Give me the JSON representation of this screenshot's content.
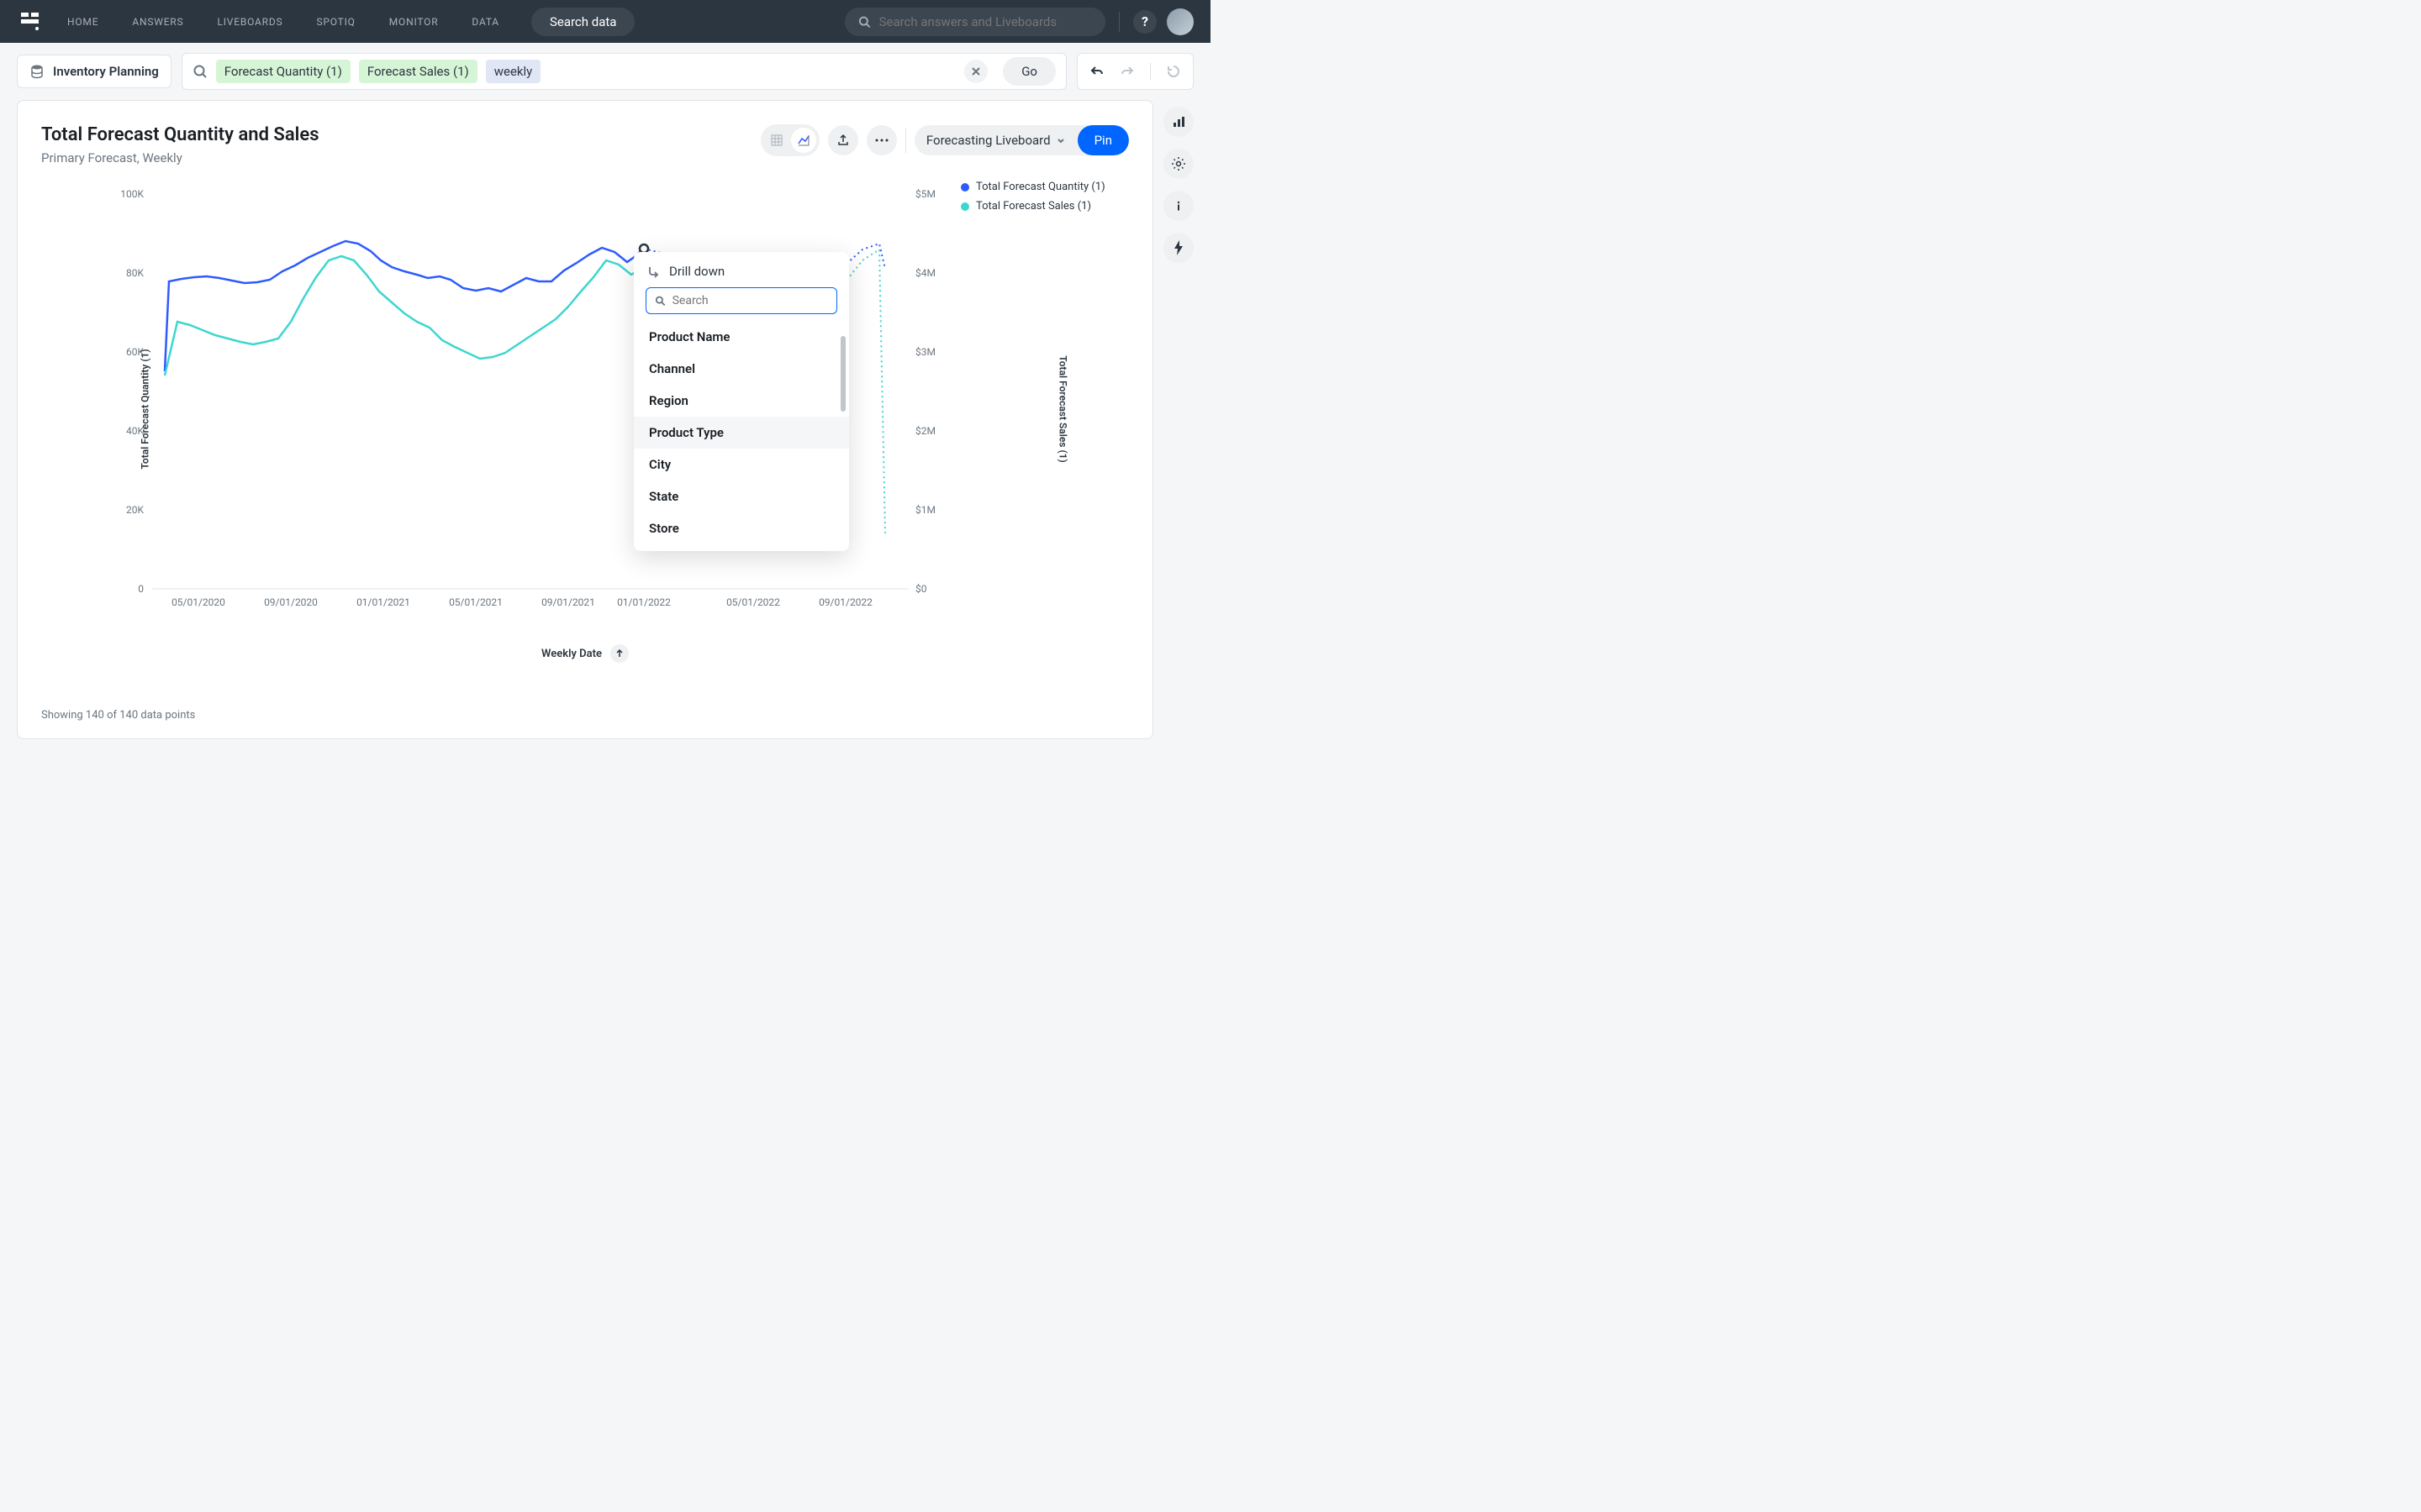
{
  "nav": {
    "items": [
      "HOME",
      "ANSWERS",
      "LIVEBOARDS",
      "SPOTIQ",
      "MONITOR",
      "DATA"
    ],
    "search_data_btn": "Search data",
    "global_search_placeholder": "Search answers and Liveboards"
  },
  "datasource": "Inventory Planning",
  "search_tokens": {
    "t0": "Forecast Quantity (1)",
    "t1": "Forecast Sales (1)",
    "t2": "weekly"
  },
  "go_btn": "Go",
  "chart": {
    "title": "Total Forecast Quantity and Sales",
    "subtitle": "Primary Forecast, Weekly",
    "liveboard_name": "Forecasting Liveboard",
    "pin_btn": "Pin",
    "y_left_label": "Total Forecast Quantity (1)",
    "y_right_label": "Total Forecast Sales (1)",
    "x_label": "Weekly Date",
    "legend": {
      "s0": "Total Forecast Quantity (1)",
      "s1": "Total Forecast Sales (1)"
    },
    "y_left_ticks": [
      "100K",
      "80K",
      "60K",
      "40K",
      "20K",
      "0"
    ],
    "y_right_ticks": [
      "$5M",
      "$4M",
      "$3M",
      "$2M",
      "$1M",
      "$0"
    ],
    "x_ticks": [
      "05/01/2020",
      "09/01/2020",
      "01/01/2021",
      "05/01/2021",
      "09/01/2021",
      "01/01/2022",
      "05/01/2022",
      "09/01/2022"
    ],
    "footer": "Showing 140 of 140 data points"
  },
  "drilldown": {
    "title": "Drill down",
    "search_placeholder": "Search",
    "items": [
      "Product Name",
      "Channel",
      "Region",
      "Product Type",
      "City",
      "State",
      "Store"
    ]
  },
  "chart_data": {
    "type": "line",
    "xlabel": "Weekly Date",
    "x_range": [
      "03/2020",
      "11/2022"
    ],
    "series": [
      {
        "name": "Total Forecast Quantity (1)",
        "color": "#2d5bff",
        "ylabel": "Total Forecast Quantity (1)",
        "ylim": [
          0,
          100000
        ],
        "values_approx": [
          55000,
          78000,
          80000,
          80000,
          81000,
          80000,
          79000,
          78000,
          79000,
          82000,
          85000,
          86000,
          88000,
          89000,
          87000,
          84000,
          82000,
          79000,
          80000,
          78000,
          77000,
          76000,
          72000,
          71000,
          72000,
          70000,
          72000,
          74000,
          73000,
          72000,
          73000,
          76000,
          79000,
          82000,
          85000,
          88000,
          87000,
          82000,
          84000,
          86000,
          88000,
          89000
        ]
      },
      {
        "name": "Total Forecast Sales (1)",
        "color": "#3dd6d0",
        "ylabel": "Total Forecast Sales (1)",
        "ylim": [
          0,
          5000000
        ],
        "values_approx": [
          2700000,
          3400000,
          3350000,
          3200000,
          3100000,
          3050000,
          3000000,
          2950000,
          3000000,
          3050000,
          3400000,
          3900000,
          4150000,
          4200000,
          4180000,
          4000000,
          3700000,
          3600000,
          3500000,
          3300000,
          3150000,
          3100000,
          2950000,
          2900000,
          2850000,
          2800000,
          2850000,
          2900000,
          3000000,
          3100000,
          3200000,
          3300000,
          3500000,
          3700000,
          3900000,
          4150000,
          4100000,
          3950000,
          4000000,
          4100000,
          4200000,
          4300000
        ]
      },
      {
        "name": "Total Forecast Quantity (1) projection",
        "color": "#2d5bff",
        "style": "dotted",
        "values_approx": [
          88000,
          87000,
          86000,
          84000,
          82000,
          80000,
          78000,
          76000,
          74000,
          73000,
          75000,
          80000,
          86000,
          88000
        ]
      },
      {
        "name": "Total Forecast Sales (1) projection",
        "color": "#3dd6d0",
        "style": "dotted",
        "values_approx": [
          4300000,
          4000000,
          3700000,
          3500000,
          3300000,
          3150000,
          3000000,
          2900000,
          2850000,
          2900000,
          3100000,
          3500000,
          4000000,
          4200000,
          700000
        ]
      }
    ]
  }
}
